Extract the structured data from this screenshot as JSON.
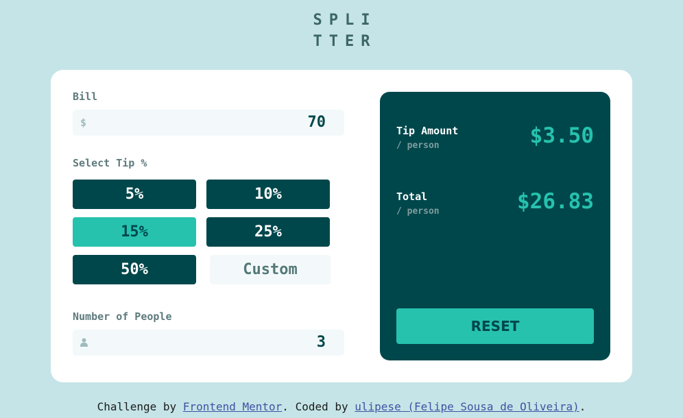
{
  "logo": {
    "line1": "SPLI",
    "line2": "TTER"
  },
  "bill": {
    "label": "Bill",
    "currency_icon": "$",
    "value": "70"
  },
  "tip": {
    "label": "Select Tip %",
    "options": [
      "5%",
      "10%",
      "15%",
      "25%",
      "50%"
    ],
    "selected": "15%",
    "custom_placeholder": "Custom"
  },
  "people": {
    "label": "Number of People",
    "icon": "person-icon",
    "value": "3"
  },
  "results": {
    "tip_title": "Tip Amount",
    "tip_sub": "/ person",
    "tip_value": "$3.50",
    "total_title": "Total",
    "total_sub": "/ person",
    "total_value": "$26.83",
    "reset_label": "RESET"
  },
  "footer": {
    "prefix": "Challenge by ",
    "link1": "Frontend Mentor",
    "middle": ". Coded by ",
    "link2": "ulipese (Felipe Sousa de Oliveira)",
    "suffix": "."
  },
  "colors": {
    "background": "#c5e4e7",
    "dark_teal": "#00474b",
    "accent": "#26c2ae",
    "input_bg": "#f3f9fa"
  }
}
